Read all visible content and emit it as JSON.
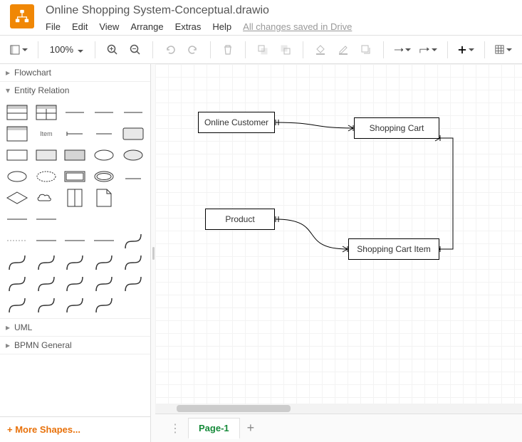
{
  "header": {
    "title": "Online Shopping System-Conceptual.drawio",
    "menu": {
      "file": "File",
      "edit": "Edit",
      "view": "View",
      "arrange": "Arrange",
      "extras": "Extras",
      "help": "Help"
    },
    "status": "All changes saved in Drive"
  },
  "toolbar": {
    "zoom": "100%"
  },
  "sidebar": {
    "sections": {
      "flowchart": "Flowchart",
      "entity_relation": "Entity Relation",
      "uml": "UML",
      "bpmn": "BPMN General"
    },
    "item_label": "Item",
    "more_shapes": "+ More Shapes..."
  },
  "canvas": {
    "nodes": {
      "online_customer": "Online Customer",
      "shopping_cart": "Shopping Cart",
      "product": "Product",
      "shopping_cart_item": "Shopping Cart Item"
    }
  },
  "tabs": {
    "page1": "Page-1"
  }
}
